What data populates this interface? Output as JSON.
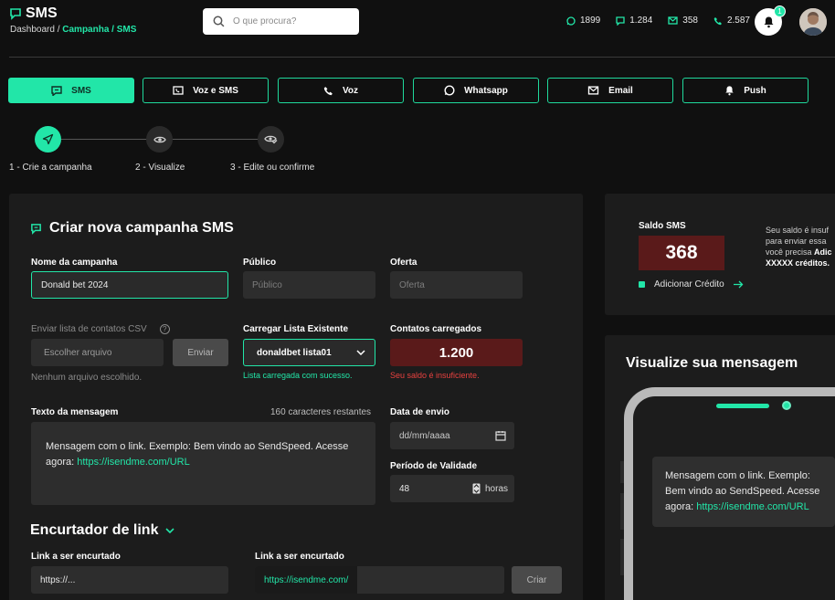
{
  "header": {
    "title": "SMS",
    "breadcrumb": {
      "root": "Dashboard",
      "sep": " / ",
      "section": "Campanha",
      "sep2": " / ",
      "page": "SMS"
    },
    "search": {
      "placeholder": "O que procura?"
    },
    "stats": [
      {
        "icon": "whatsapp-icon",
        "value": "1899"
      },
      {
        "icon": "message-icon",
        "value": "1.284"
      },
      {
        "icon": "email-icon",
        "value": "358"
      },
      {
        "icon": "phone-icon",
        "value": "2.587"
      }
    ],
    "notifications_count": "1"
  },
  "channels": [
    {
      "label": "SMS",
      "icon": "sms-icon",
      "active": true
    },
    {
      "label": "Voz e SMS",
      "icon": "voice-sms-icon",
      "active": false
    },
    {
      "label": "Voz",
      "icon": "phone-icon",
      "active": false
    },
    {
      "label": "Whatsapp",
      "icon": "whatsapp-icon",
      "active": false
    },
    {
      "label": "Email",
      "icon": "email-icon",
      "active": false
    },
    {
      "label": "Push",
      "icon": "bell-icon",
      "active": false
    }
  ],
  "steps": [
    {
      "label": "1 - Crie a campanha",
      "icon": "send-icon"
    },
    {
      "label": "2 - Visualize",
      "icon": "eye-icon"
    },
    {
      "label": "3 - Edite ou confirme",
      "icon": "eye-check-icon"
    }
  ],
  "form": {
    "title": "Criar nova campanha SMS",
    "campaign_name": {
      "label": "Nome da campanha",
      "value": "Donald bet 2024"
    },
    "audience": {
      "label": "Público",
      "placeholder": "Público"
    },
    "offer": {
      "label": "Oferta",
      "placeholder": "Oferta"
    },
    "csv": {
      "label": "Enviar lista de contatos CSV",
      "help_icon": "?",
      "button": "Escolher arquivo",
      "send": "Enviar",
      "status": "Nenhum arquivo escolhido."
    },
    "existing_list": {
      "label": "Carregar Lista Existente",
      "value": "donaldbet lista01",
      "status": "Lista carregada com sucesso."
    },
    "contacts": {
      "label": "Contatos carregados",
      "value": "1.200",
      "status": "Seu saldo é insuficiente."
    },
    "message": {
      "label": "Texto da mensagem",
      "remaining": "160 caracteres restantes",
      "text": "Mensagem com o link. Exemplo: Bem vindo ao SendSpeed.  Acesse agora: ",
      "link": "https://isendme.com/URL"
    },
    "send_date": {
      "label": "Data de envio",
      "placeholder": "dd/mm/aaaa"
    },
    "validity": {
      "label": "Período de Validade",
      "value": "48",
      "unit": "horas"
    }
  },
  "shortener": {
    "title": "Encurtador de link",
    "link_label_1": "Link a ser encurtado",
    "link_value_1": "https://...",
    "link_label_2": "Link a ser encurtado",
    "link_value_2": "https://isendme.com/",
    "create": "Criar"
  },
  "balance": {
    "title": "Saldo SMS",
    "value": "368",
    "add_credit": "Adicionar Crédito",
    "note_line1": "Seu saldo é insuf",
    "note_line2": "para enviar essa",
    "note_line3a": "você precisa ",
    "note_line3b": "Adic",
    "note_line4": "XXXXX créditos."
  },
  "preview": {
    "title": "Visualize sua mensagem",
    "text": "Mensagem com o link. Exemplo: Bem vindo ao SendSpeed. Acesse agora: ",
    "link": "https://isendme.com/URL"
  },
  "colors": {
    "accent": "#22e6a8",
    "danger_bg": "#5a1a1a",
    "danger_text": "#e8413f",
    "panel": "#1c1c1c",
    "background": "#101010"
  }
}
